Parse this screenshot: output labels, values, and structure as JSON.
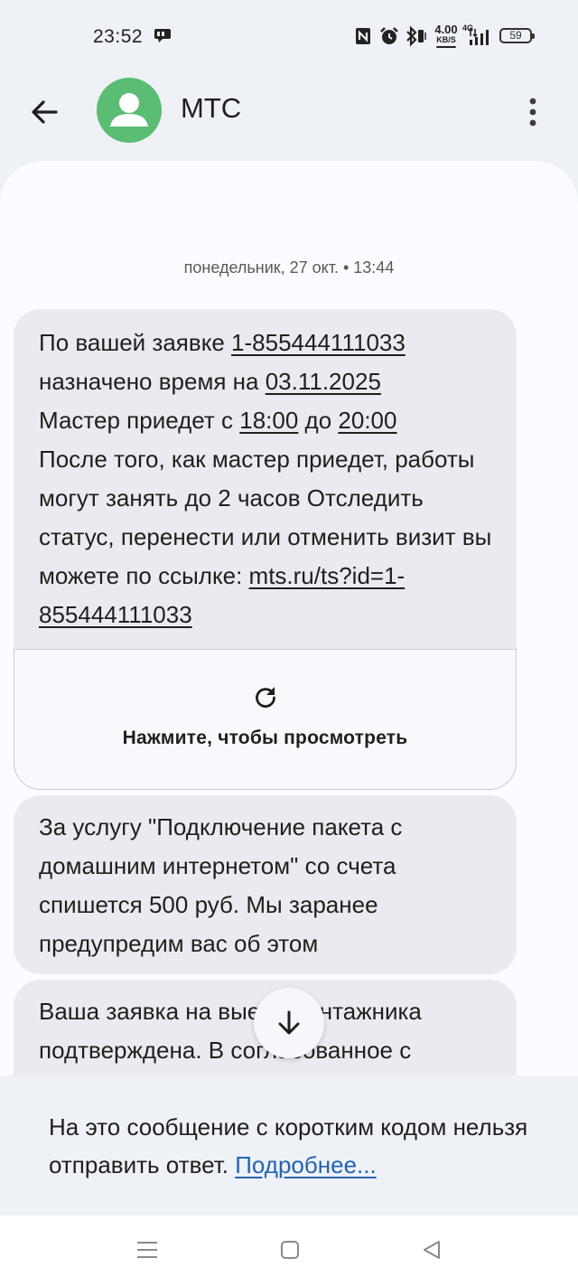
{
  "status_bar": {
    "time": "23:52",
    "speed_value": "4.00",
    "speed_unit": "KB/S",
    "network": "4G",
    "battery": "59",
    "icons": [
      "chat-icon",
      "nfc-icon",
      "alarm-icon",
      "bluetooth-icon",
      "vibrate-icon",
      "signal-icon",
      "battery-icon"
    ]
  },
  "header": {
    "title": "МТС",
    "back_icon": "arrow-left-icon",
    "avatar_icon": "person-icon",
    "more_icon": "more-vert-icon",
    "avatar_color": "#5bbc74"
  },
  "conversation": {
    "date_separator": "понедельник, 27 окт. • 13:44",
    "message1": {
      "t1": "По вашей заявке ",
      "order_id": "1-855444111033",
      "t2": "назначено время на ",
      "date": "03.11.2025",
      "t3": "Мастер приедет с ",
      "time_from": "18:00",
      "t4": " до ",
      "time_to": "20:00",
      "t5": "После того, как мастер приедет, работы могут занять до 2 часов Отследить статус, перенести или отменить визит вы можете по ссылке: ",
      "link": "mts.ru/ts?id=1-855444111033"
    },
    "preview": {
      "label": "Нажмите, чтобы просмотреть",
      "icon": "refresh-icon"
    },
    "message2": "За услугу \"Подключение пакета с домашним интернетом\" со счета спишется 500 руб. Мы заранее предупредим вас об этом",
    "message3": "Ваша заявка на выезд монтажника подтверждена.  В согласованное с",
    "scroll_down_icon": "arrow-down-icon"
  },
  "footer": {
    "notice": "На это сообщение с коротким кодом нельзя отправить ответ. ",
    "link": "Подробнее..."
  },
  "navbar": {
    "icons": [
      "menu-icon",
      "home-square-icon",
      "back-triangle-icon"
    ]
  },
  "colors": {
    "background": "#eef1f6",
    "bubble": "#e9ebf0",
    "link": "#2563b0"
  }
}
